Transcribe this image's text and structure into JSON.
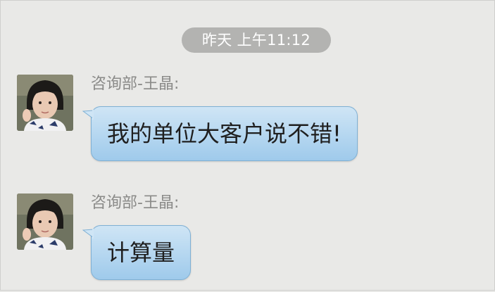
{
  "timestamp": "昨天 上午11:12",
  "messages": [
    {
      "sender": "咨询部-王晶:",
      "text": "我的单位大客户说不错!"
    },
    {
      "sender": "咨询部-王晶:",
      "text": "计算量"
    }
  ],
  "colors": {
    "background": "#e9e9e7",
    "timestamp_pill": "#b3b3b1",
    "bubble": "#b9d9f1",
    "bubble_border": "#7fb0d4",
    "sender_text": "#8a8a88"
  }
}
